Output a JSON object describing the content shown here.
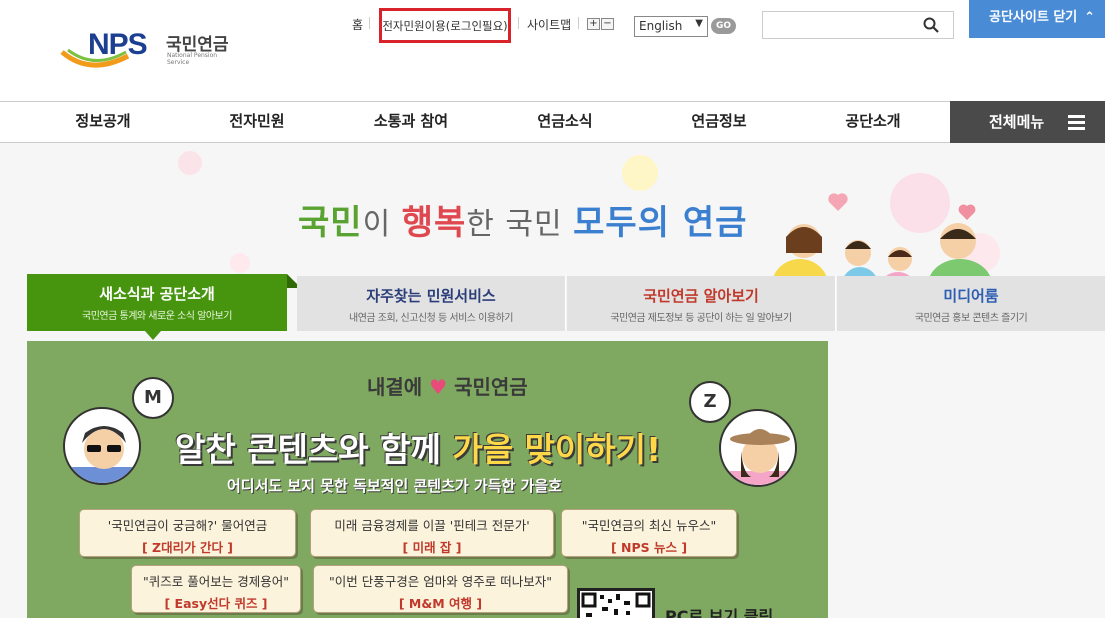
{
  "header": {
    "logo": {
      "brand": "NPS",
      "ko_name": "국민연금",
      "en_name": "National Pension Service"
    },
    "util": {
      "home": "홈",
      "login": "전자민원이용(로그인필요)",
      "sitemap": "사이트맵",
      "zoom_in": "+",
      "zoom_out": "−",
      "language": "English",
      "go": "GO"
    },
    "search": {
      "placeholder": "",
      "icon": "search-icon"
    },
    "close_site": "공단사이트 닫기"
  },
  "nav": {
    "items": [
      "정보공개",
      "전자민원",
      "소통과 참여",
      "연금소식",
      "연금정보",
      "공단소개"
    ],
    "all_menu": "전체메뉴"
  },
  "hero": {
    "slogan": {
      "part1": "국민",
      "part2": "이 ",
      "part3": "행복",
      "part4": "한 국민 ",
      "part5": "모두의",
      "part6": " 연금"
    }
  },
  "tabs": [
    {
      "title": "새소식과 공단소개",
      "sub": "국민연금 통계와 새로운 소식 알아보기",
      "active": true,
      "title_color": "#ffffff"
    },
    {
      "title": "자주찾는 민원서비스",
      "sub": "내연금 조회, 신고신청 등 서비스 이용하기",
      "active": false,
      "title_color": "#2c3e7a"
    },
    {
      "title": "국민연금 알아보기",
      "sub": "국민연금 제도정보 등 공단이 하는 일 알아보기",
      "active": false,
      "title_color": "#c0392b"
    },
    {
      "title": "미디어룸",
      "sub": "국민연금 홍보 콘텐츠 즐기기",
      "active": false,
      "title_color": "#2c5fb3"
    }
  ],
  "banner": {
    "head_left": "내곁에",
    "head_right": "국민연금",
    "title_a": "알찬 콘텐츠와 함께 ",
    "title_b": "가을 맞이하기!",
    "sub": "어디서도 보지 못한 독보적인 콘텐츠가 가득한 가을호",
    "bubble_m": "M",
    "bubble_z": "Z",
    "cards": [
      {
        "q": "'국민연금이 궁금해?' 물어연금",
        "tag": "[ Z대리가 간다 ]"
      },
      {
        "q": "미래 금융경제를 이끌 '핀테크 전문가'",
        "tag": "[ 미래 잡 ]"
      },
      {
        "q": "\"국민연금의 최신 뉴우스\"",
        "tag": "[ NPS 뉴스 ]"
      },
      {
        "q": "\"퀴즈로 풀어보는 경제용어\"",
        "tag": "[ Easy선다 퀴즈 ]"
      },
      {
        "q": "\"이번 단풍구경은 엄마와 영주로 떠나보자\"",
        "tag": "[ M&M 여행 ]"
      }
    ],
    "pc_label": "PC로 보기 클릭"
  },
  "colors": {
    "primary_green": "#47950f",
    "brand_blue": "#1d3f91",
    "close_blue": "#4a8bd6",
    "login_highlight": "#d8232a",
    "banner_green": "#7fa860"
  }
}
